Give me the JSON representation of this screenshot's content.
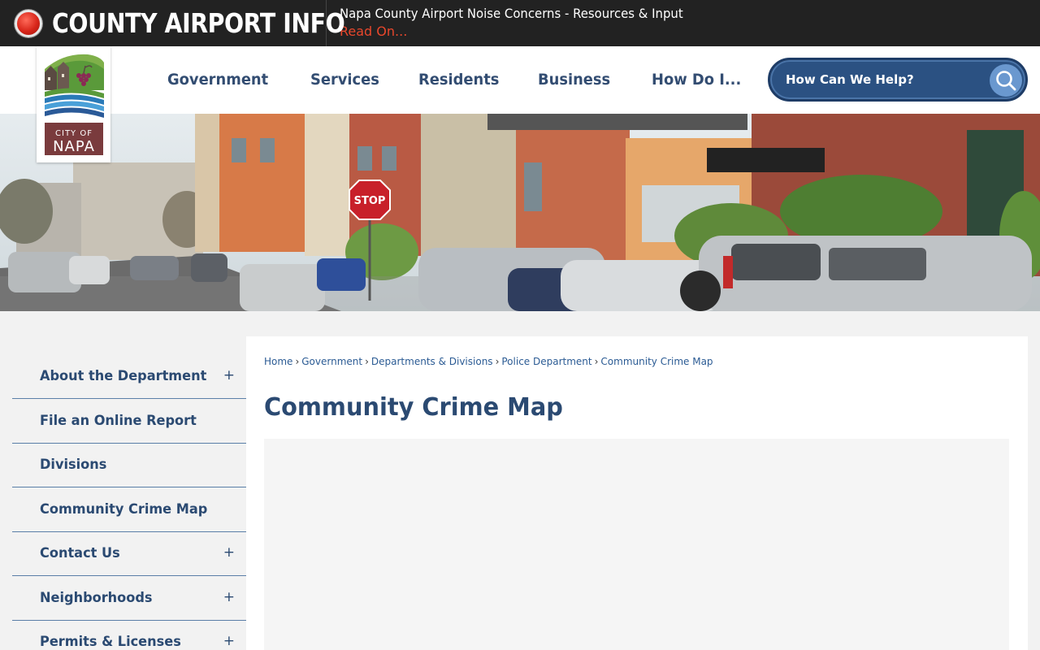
{
  "alert": {
    "title": "COUNTY AIRPORT INFO",
    "message": "Napa County Airport Noise Concerns - Resources & Input",
    "link_text": "Read On..."
  },
  "logo": {
    "line1": "CITY OF",
    "line2": "NAPA"
  },
  "nav": {
    "items": [
      {
        "label": "Government"
      },
      {
        "label": "Services"
      },
      {
        "label": "Residents"
      },
      {
        "label": "Business"
      },
      {
        "label": "How Do I..."
      }
    ]
  },
  "search": {
    "placeholder": "How Can We Help?",
    "icon": "search-icon"
  },
  "banner": {
    "stop_sign_text": "STOP"
  },
  "sidebar": {
    "items": [
      {
        "label": "About the Department",
        "expandable": "+"
      },
      {
        "label": "File an Online Report",
        "expandable": ""
      },
      {
        "label": "Divisions",
        "expandable": ""
      },
      {
        "label": "Community Crime Map",
        "expandable": ""
      },
      {
        "label": "Contact Us",
        "expandable": "+"
      },
      {
        "label": "Neighborhoods",
        "expandable": "+"
      },
      {
        "label": "Permits & Licenses",
        "expandable": "+"
      }
    ]
  },
  "breadcrumb": {
    "items": [
      "Home",
      "Government",
      "Departments & Divisions",
      "Police Department",
      "Community Crime Map"
    ],
    "separator": "›"
  },
  "page": {
    "title": "Community Crime Map"
  },
  "colors": {
    "alert_bg": "#222222",
    "alert_link": "#e8472c",
    "nav_text": "#334d72",
    "search_bg": "#2b5182",
    "page_bg": "#f2f2f2"
  }
}
